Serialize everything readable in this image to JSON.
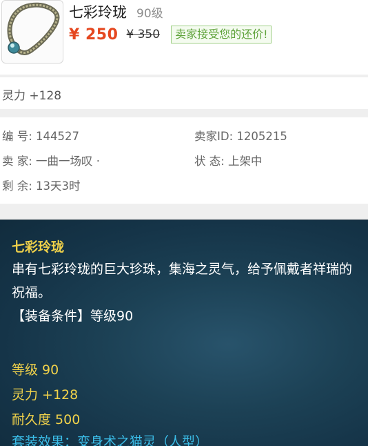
{
  "item": {
    "name": "七彩玲珑",
    "level": "90级",
    "price_current": "¥ 250",
    "price_original": "¥ 350",
    "bargain_badge": "卖家接受您的还价!"
  },
  "attribute": {
    "text": "灵力 +128"
  },
  "info": {
    "number_label": "编 号: 144527",
    "seller_id_label": "卖家ID: 1205215",
    "seller_label": "卖 家: 一曲一场叹 ·",
    "status_label": "状 态: 上架中",
    "remaining_label": "剩 余: 13天3时"
  },
  "description": {
    "title": "七彩玲珑",
    "text": "串有七彩玲珑的巨大珍珠，集海之灵气，给予佩戴者祥瑞的祝福。",
    "condition": "【装备条件】等级90",
    "stats": [
      "等级 90",
      "灵力 +128",
      "耐久度 500"
    ],
    "set_effect": "套装效果：变身术之猫灵（人型）"
  },
  "icons": {
    "item_icon": "necklace-icon"
  },
  "colors": {
    "price": "#e5471f",
    "badge_text": "#5fa33b",
    "panel_bg": "#1c4155",
    "gold_text": "#f1d24a",
    "set_effect": "#3bbde8"
  }
}
